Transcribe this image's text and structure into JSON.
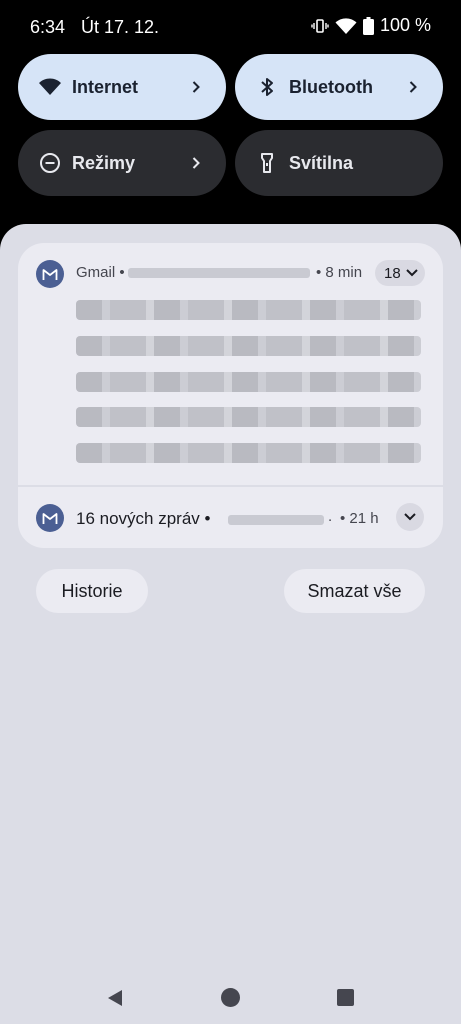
{
  "status_bar": {
    "time": "6:34",
    "date": "Út 17. 12.",
    "battery": "100 %"
  },
  "quick_settings": {
    "tiles": [
      {
        "label": "Internet",
        "state": "on",
        "icon": "wifi-icon"
      },
      {
        "label": "Bluetooth",
        "state": "on",
        "icon": "bluetooth-icon"
      },
      {
        "label": "Režimy",
        "state": "off",
        "icon": "do-not-disturb-icon"
      },
      {
        "label": "Svítilna",
        "state": "off",
        "icon": "flashlight-icon"
      }
    ]
  },
  "notifications": {
    "gmail": {
      "app_name": "Gmail •",
      "time": "• 8 min",
      "count": "18"
    },
    "summary": {
      "title": "16 nových zpráv •",
      "dot": ".",
      "time": "• 21 h"
    }
  },
  "actions": {
    "history_label": "Historie",
    "clear_all_label": "Smazat vše"
  },
  "colors": {
    "tile_on": "#d6e4f7",
    "tile_off": "#2b2c30",
    "shade_bg": "#dcdde6",
    "card_bg": "#ebebf2",
    "gmail_badge": "#4b5f93"
  }
}
